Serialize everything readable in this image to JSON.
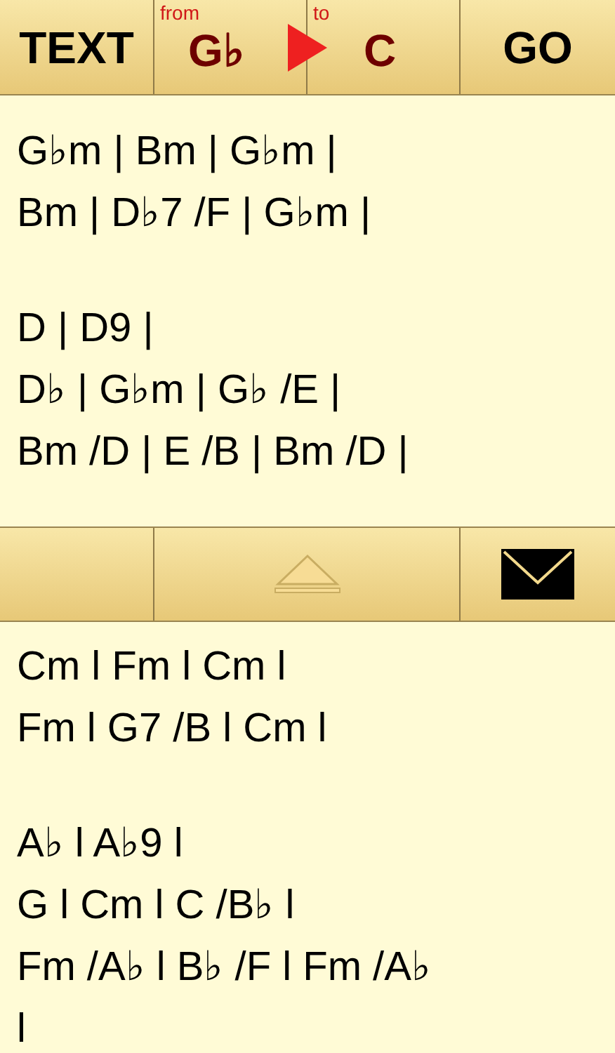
{
  "toolbar": {
    "text_button": "TEXT",
    "from": {
      "label": "from",
      "key": "G♭"
    },
    "to": {
      "label": "to",
      "key": "C"
    },
    "go_button": "GO"
  },
  "original": {
    "stanzas": [
      [
        "G♭m | Bm | G♭m |",
        "Bm | D♭7 /F | G♭m |"
      ],
      [
        "D | D9 |",
        "D♭ | G♭m | G♭ /E |",
        "Bm /D | E /B | Bm /D |"
      ]
    ]
  },
  "transposed": {
    "stanzas": [
      [
        "Cm l Fm l Cm l",
        "Fm l G7 /B l Cm l"
      ],
      [
        "A♭ l A♭9 l",
        "G l Cm l C /B♭ l",
        "Fm /A♭ l B♭ /F l Fm /A♭",
        "l"
      ]
    ]
  }
}
